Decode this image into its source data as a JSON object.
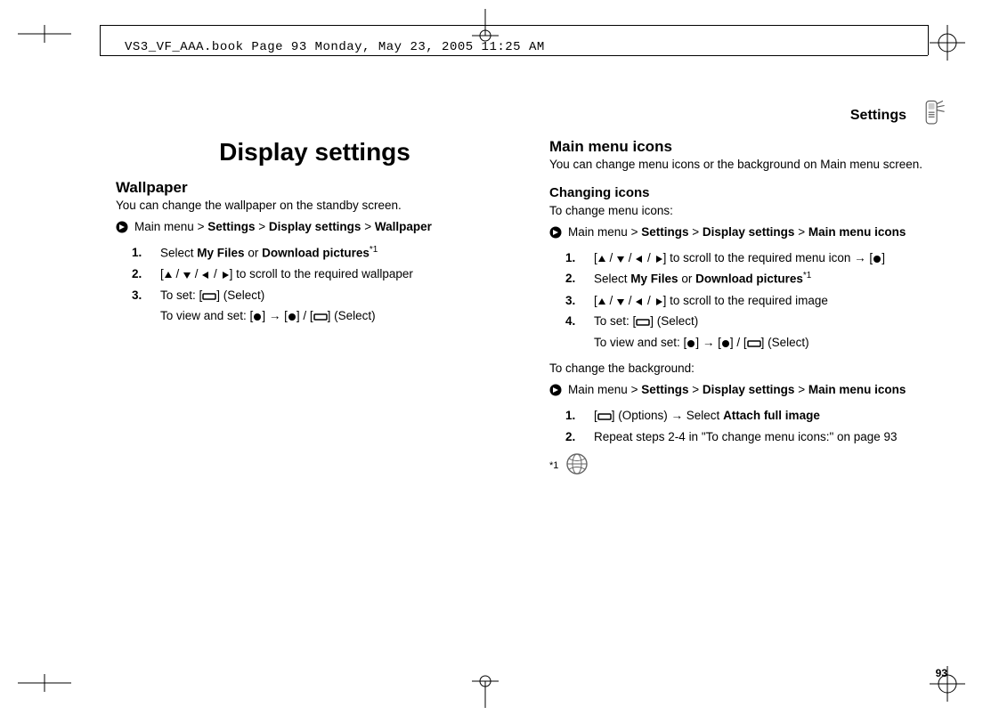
{
  "running_head": "VS3_VF_AAA.book  Page 93  Monday, May 23, 2005  11:25 AM",
  "header": {
    "title": "Settings"
  },
  "page_number": "93",
  "left": {
    "h1": "Display settings",
    "wallpaper": {
      "heading": "Wallpaper",
      "lead": "You can change the wallpaper on the standby screen.",
      "path_prefix": "Main menu",
      "path_seg1": "Settings",
      "path_seg2": "Display settings",
      "path_seg3": "Wallpaper",
      "steps": {
        "s1_num": "1.",
        "s1_a": "Select ",
        "s1_b": "My Files",
        "s1_c": " or ",
        "s1_d": "Download pictures",
        "s1_sup": "*1",
        "s2_num": "2.",
        "s2_a": "[",
        "s2_b": "] to scroll to the required wallpaper",
        "s3_num": "3.",
        "s3_a": "To set: [",
        "s3_b": "] (Select)",
        "s3_sub_a": "To view and set: [",
        "s3_sub_b": "] → [",
        "s3_sub_c": "] / [",
        "s3_sub_d": "] (Select)"
      }
    }
  },
  "right": {
    "mmicons": {
      "heading": "Main menu icons",
      "lead": "You can change menu icons or the background on Main menu screen.",
      "sub1": "Changing icons",
      "sub2": "To change menu icons:",
      "path_prefix": "Main menu",
      "path_seg1": "Settings",
      "path_seg2": "Display settings",
      "path_seg3": "Main menu icons",
      "steps": {
        "s1_num": "1.",
        "s1_a": "[",
        "s1_b": "] to scroll to the required menu icon → [",
        "s1_c": "]",
        "s2_num": "2.",
        "s2_a": "Select ",
        "s2_b": "My Files",
        "s2_c": " or ",
        "s2_d": "Download pictures",
        "s2_sup": "*1",
        "s3_num": "3.",
        "s3_a": "[",
        "s3_b": "] to scroll to the required image",
        "s4_num": "4.",
        "s4_a": "To set: [",
        "s4_b": "] (Select)",
        "s4_sub_a": "To view and set: [",
        "s4_sub_b": "] → [",
        "s4_sub_c": "] / [",
        "s4_sub_d": "] (Select)"
      },
      "bg_heading": "To change the background:",
      "bg_path_prefix": "Main menu",
      "bg_path_seg1": "Settings",
      "bg_path_seg2": "Display settings",
      "bg_path_seg3": "Main menu icons",
      "bg_steps": {
        "s1_num": "1.",
        "s1_a": "[",
        "s1_b": "] (Options) → Select ",
        "s1_c": "Attach full image",
        "s2_num": "2.",
        "s2_a": "Repeat steps 2-4 in \"To change menu icons:\" on page 93"
      },
      "footnote_label": "*1"
    }
  },
  "glyphs": {
    "gt": ">",
    "slash": " / "
  }
}
